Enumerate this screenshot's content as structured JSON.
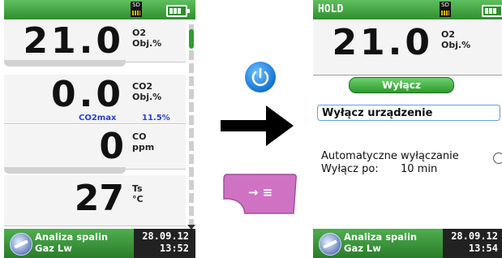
{
  "left_screen": {
    "readings": [
      {
        "value": "21.0",
        "unit_line1": "O2",
        "unit_line2": "Obj.%"
      },
      {
        "value": "0.0",
        "unit_line1": "CO2",
        "unit_line2": "Obj.%",
        "sub_label": "CO2max",
        "sub_value": "11.5%"
      },
      {
        "value": "0",
        "unit_line1": "CO",
        "unit_line2": "ppm"
      },
      {
        "value": "27",
        "unit_line1": "Ts",
        "unit_line2": "°C"
      }
    ],
    "sd_label": "SD",
    "bottom": {
      "line1": "Analiza spalin",
      "line2": "Gaz Lw",
      "date": "28.09.12",
      "time": "13:52"
    }
  },
  "right_screen": {
    "status_title": "HOLD",
    "sd_label": "SD",
    "reading": {
      "value": "21.0",
      "unit_line1": "O2",
      "unit_line2": "Obj.%"
    },
    "dialog": {
      "title": "Wyłącz",
      "item_shutdown": "Wyłącz urządzenie",
      "item_auto": "Automatyczne wyłączanie",
      "item_after_label": "Wyłącz po:",
      "item_after_value": "10 min"
    },
    "bottom": {
      "line1": "Analiza spalin",
      "line2": "Gaz Lw",
      "date": "28.09.12",
      "time": "13:54"
    }
  },
  "middle": {
    "power_icon": "power-icon",
    "arrow_icon": "right-arrow-icon",
    "key_icon": "enter-menu-key-icon",
    "key_symbol": "→ ≡"
  },
  "colors": {
    "accent_green": "#2e9e2e",
    "selection_blue": "#5aa0e8",
    "power_blue": "#1a78d8",
    "key_pink": "#d072c4",
    "co2max_blue": "#2a3fd0"
  }
}
